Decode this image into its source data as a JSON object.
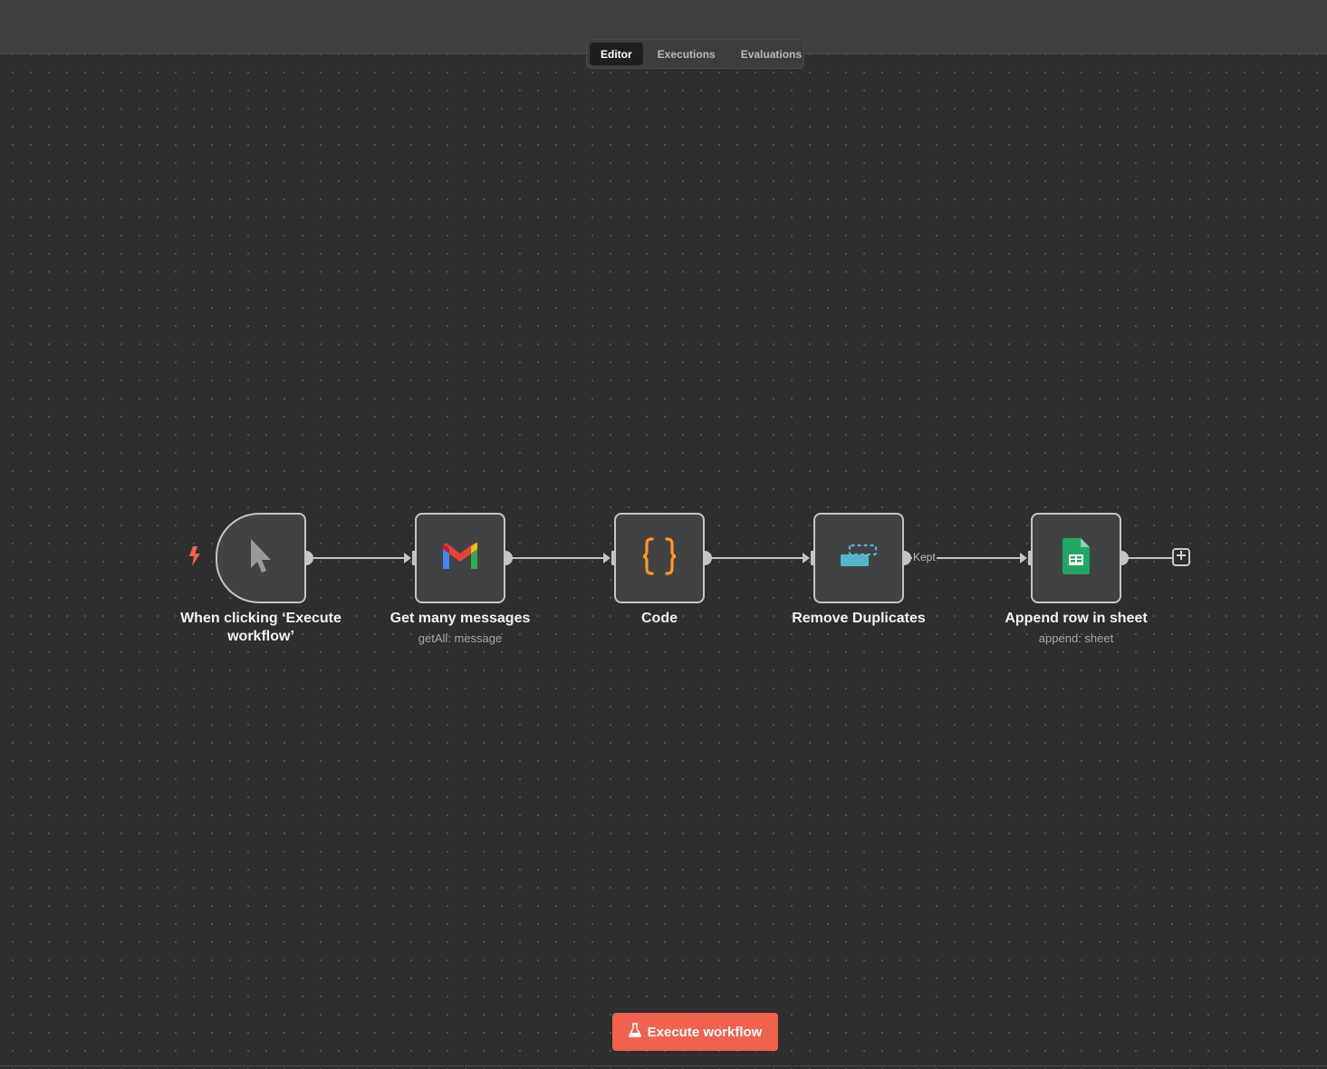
{
  "tabs": {
    "editor": "Editor",
    "executions": "Executions",
    "evaluations": "Evaluations"
  },
  "nodes": {
    "trigger": {
      "label": "When clicking ‘Execute workflow’",
      "icon": "cursor-icon"
    },
    "gmail": {
      "label": "Get many messages",
      "sublabel": "getAll: message",
      "icon": "gmail-icon"
    },
    "code": {
      "label": "Code",
      "icon": "braces-icon"
    },
    "dedupe": {
      "label": "Remove Duplicates",
      "icon": "remove-duplicates-icon"
    },
    "sheets": {
      "label": "Append row in sheet",
      "sublabel": "append: sheet",
      "icon": "google-sheets-icon"
    }
  },
  "connections": {
    "kept_label": "Kept"
  },
  "execute_button": {
    "label": "Execute workflow",
    "icon": "flask-icon"
  },
  "colors": {
    "accent": "#f0614f",
    "canvas": "#2e2e2e",
    "node_fill": "#414244",
    "code_icon": "#ff9922",
    "dedupe_icon": "#56b6c9",
    "sheets_icon": "#23a566"
  }
}
